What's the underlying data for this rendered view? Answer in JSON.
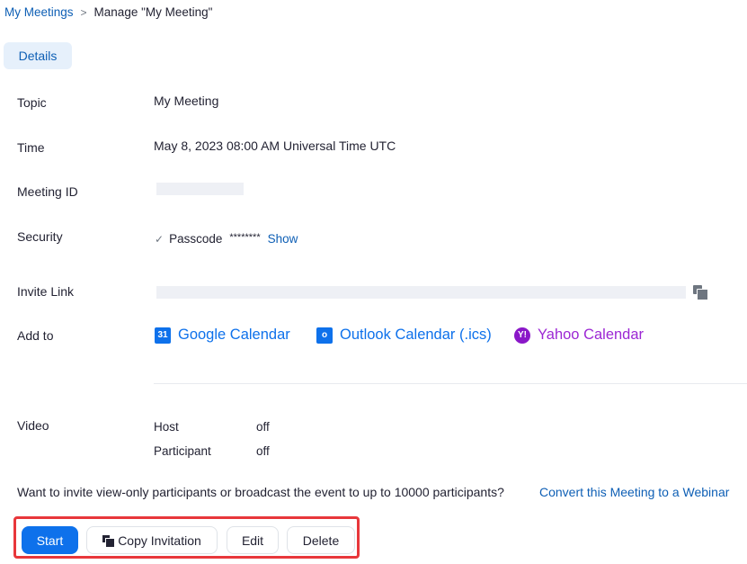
{
  "breadcrumb": {
    "parent": "My Meetings",
    "separator": ">",
    "current": "Manage \"My Meeting\""
  },
  "tabs": [
    {
      "label": "Details",
      "active": true
    }
  ],
  "fields": {
    "topic": {
      "label": "Topic",
      "value": "My Meeting"
    },
    "time": {
      "label": "Time",
      "value": "May 8, 2023 08:00 AM Universal Time UTC"
    },
    "meeting_id": {
      "label": "Meeting ID",
      "value": ""
    },
    "security": {
      "label": "Security",
      "check": "✓",
      "item": "Passcode",
      "masked": "********",
      "show_label": "Show"
    },
    "invite_link": {
      "label": "Invite Link",
      "value": ""
    },
    "add_to": {
      "label": "Add to",
      "calendars": [
        {
          "name": "Google Calendar",
          "icon": "google-calendar-icon",
          "color": "#0e71eb"
        },
        {
          "name": "Outlook Calendar (.ics)",
          "icon": "outlook-icon",
          "color": "#0e71eb"
        },
        {
          "name": "Yahoo Calendar",
          "icon": "yahoo-icon",
          "color": "#9c27d4"
        }
      ]
    },
    "video": {
      "label": "Video",
      "rows": [
        {
          "name": "Host",
          "value": "off"
        },
        {
          "name": "Participant",
          "value": "off"
        }
      ]
    }
  },
  "webinar": {
    "prompt": "Want to invite view-only participants or broadcast the event to up to 10000 participants?",
    "link": "Convert this Meeting to a Webinar"
  },
  "actions": {
    "start": "Start",
    "copy_invitation": "Copy Invitation",
    "edit": "Edit",
    "delete": "Delete"
  },
  "colors": {
    "accent": "#0e71eb",
    "highlight_border": "#e8373b"
  }
}
